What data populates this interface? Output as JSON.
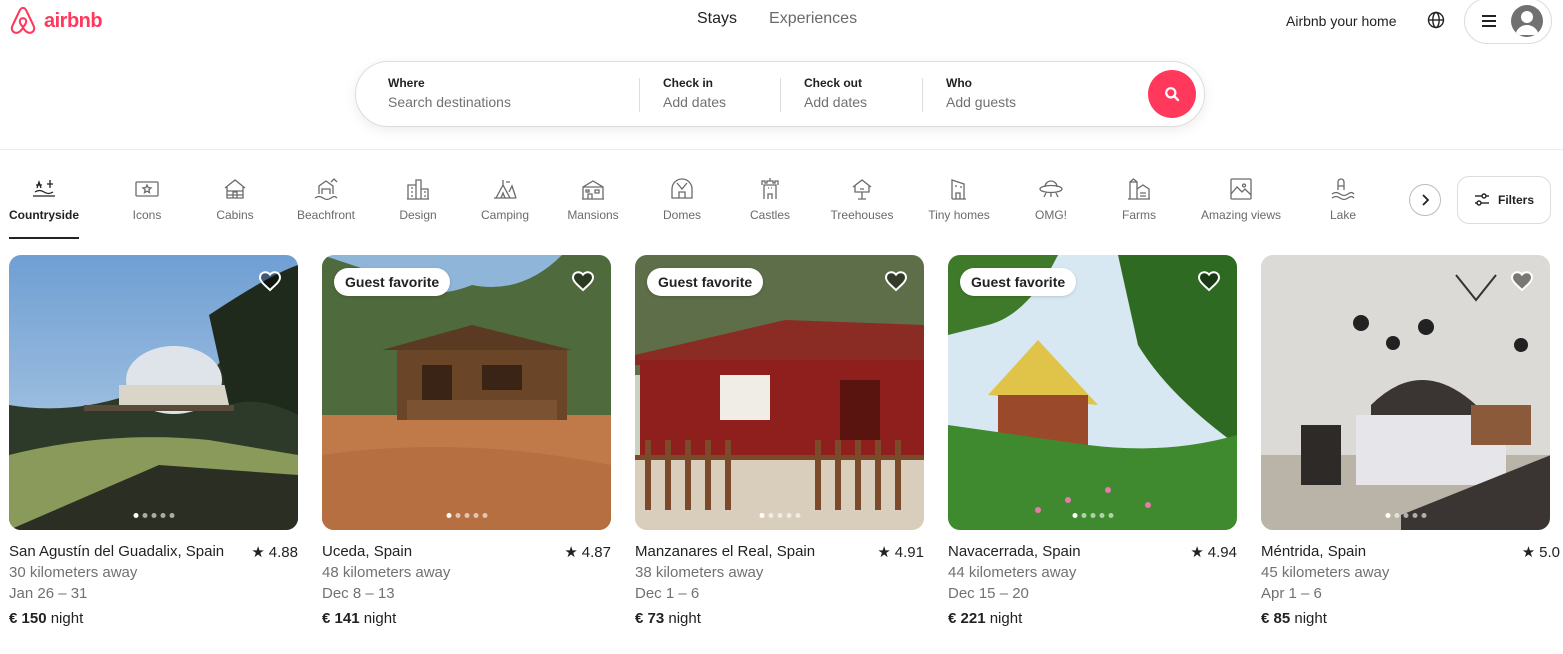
{
  "header": {
    "logo_text": "airbnb",
    "tabs": [
      {
        "label": "Stays",
        "active": true
      },
      {
        "label": "Experiences",
        "active": false
      }
    ],
    "host_link": "Airbnb your home"
  },
  "search": {
    "where": {
      "label": "Where",
      "placeholder": "Search destinations"
    },
    "check_in": {
      "label": "Check in",
      "placeholder": "Add dates"
    },
    "check_out": {
      "label": "Check out",
      "placeholder": "Add dates"
    },
    "who": {
      "label": "Who",
      "placeholder": "Add guests"
    }
  },
  "categories": [
    {
      "label": "Countryside",
      "icon": "countryside-icon",
      "active": true
    },
    {
      "label": "Icons",
      "icon": "icons-icon"
    },
    {
      "label": "Cabins",
      "icon": "cabin-icon"
    },
    {
      "label": "Beachfront",
      "icon": "beachfront-icon"
    },
    {
      "label": "Design",
      "icon": "design-icon"
    },
    {
      "label": "Camping",
      "icon": "camping-icon"
    },
    {
      "label": "Mansions",
      "icon": "mansion-icon"
    },
    {
      "label": "Domes",
      "icon": "dome-icon"
    },
    {
      "label": "Castles",
      "icon": "castle-icon"
    },
    {
      "label": "Treehouses",
      "icon": "treehouse-icon"
    },
    {
      "label": "Tiny homes",
      "icon": "tiny-home-icon"
    },
    {
      "label": "OMG!",
      "icon": "ufo-icon"
    },
    {
      "label": "Farms",
      "icon": "farm-icon"
    },
    {
      "label": "Amazing views",
      "icon": "view-icon"
    },
    {
      "label": "Lake",
      "icon": "lake-icon"
    }
  ],
  "filters_label": "Filters",
  "listings": [
    {
      "location": "San Agustín del Guadalix, Spain",
      "rating": "4.88",
      "distance": "30 kilometers away",
      "dates": "Jan 26 – 31",
      "price": "€ 150",
      "unit": "night",
      "badge": ""
    },
    {
      "location": "Uceda, Spain",
      "rating": "4.87",
      "distance": "48 kilometers away",
      "dates": "Dec 8 – 13",
      "price": "€ 141",
      "unit": "night",
      "badge": "Guest favorite"
    },
    {
      "location": "Manzanares el Real, Spain",
      "rating": "4.91",
      "distance": "38 kilometers away",
      "dates": "Dec 1 – 6",
      "price": "€ 73",
      "unit": "night",
      "badge": "Guest favorite"
    },
    {
      "location": "Navacerrada, Spain",
      "rating": "4.94",
      "distance": "44 kilometers away",
      "dates": "Dec 15 – 20",
      "price": "€ 221",
      "unit": "night",
      "badge": "Guest favorite"
    },
    {
      "location": "Méntrida, Spain",
      "rating": "5.0",
      "distance": "45 kilometers away",
      "dates": "Apr 1 – 6",
      "price": "€ 85",
      "unit": "night",
      "badge": ""
    }
  ],
  "colors": {
    "brand": "#ff385c",
    "text": "#222222",
    "muted": "#717171"
  }
}
